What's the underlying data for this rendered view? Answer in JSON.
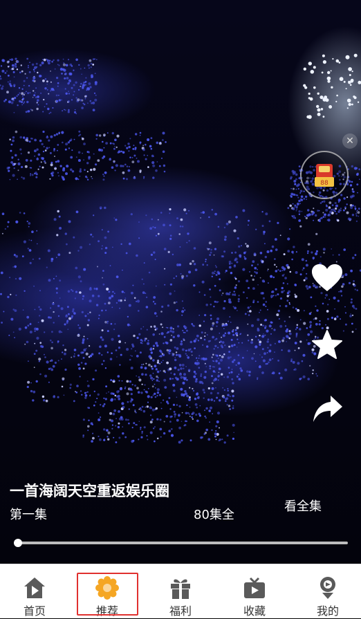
{
  "video": {
    "title": "一首海阔天空重返娱乐圈",
    "episode": "第一集",
    "total_episodes": "80集全",
    "view_all": "看全集",
    "progress": 0.0
  },
  "side_actions": {
    "redpacket_badge": "88",
    "close_glyph": "✕",
    "like_icon": "heart-icon",
    "favorite_icon": "star-icon",
    "share_icon": "share-icon"
  },
  "tabbar": {
    "items": [
      {
        "label": "首页",
        "icon": "home-icon"
      },
      {
        "label": "推荐",
        "icon": "gear-flower-icon",
        "active": true
      },
      {
        "label": "福利",
        "icon": "gift-icon"
      },
      {
        "label": "收藏",
        "icon": "tv-icon"
      },
      {
        "label": "我的",
        "icon": "person-icon"
      }
    ]
  },
  "colors": {
    "accent": "#f5a623",
    "highlight": "#e0302e",
    "tab_icon": "#5a5a5a",
    "crowd": "#4a55e8"
  }
}
